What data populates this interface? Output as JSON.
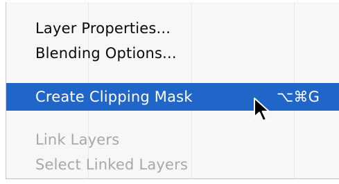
{
  "menu": {
    "items": [
      {
        "label": "Layer Properties...",
        "enabled": true
      },
      {
        "label": "Blending Options...",
        "enabled": true
      },
      {
        "label": "Create Clipping Mask",
        "shortcut": "⌥⌘G",
        "enabled": true,
        "highlighted": true
      },
      {
        "label": "Link Layers",
        "enabled": false
      },
      {
        "label": "Select Linked Layers",
        "enabled": false
      }
    ],
    "highlight_color": "#2066c8",
    "disabled_color": "#a7a7a7"
  },
  "cursor": {
    "icon": "arrow-pointer-icon"
  }
}
